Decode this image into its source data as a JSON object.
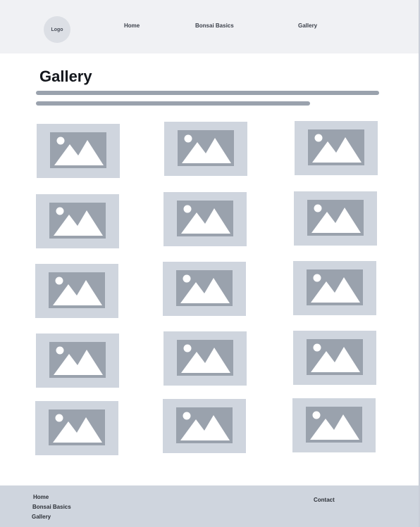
{
  "header": {
    "logo_label": "Logo",
    "nav": [
      {
        "label": "Home"
      },
      {
        "label": "Bonsai Basics"
      },
      {
        "label": "Gallery"
      }
    ]
  },
  "main": {
    "title": "Gallery",
    "gallery": {
      "columns": 3,
      "rows": 5,
      "placeholder_icon": "image-placeholder-icon",
      "placeholder_colors": {
        "tile": "#cfd5de",
        "frame": "#9aa2ad",
        "shapes": "#ffffff"
      }
    }
  },
  "footer": {
    "links": [
      {
        "label": "Home"
      },
      {
        "label": "Bonsai Basics"
      },
      {
        "label": "Gallery"
      }
    ],
    "contact_label": "Contact"
  }
}
